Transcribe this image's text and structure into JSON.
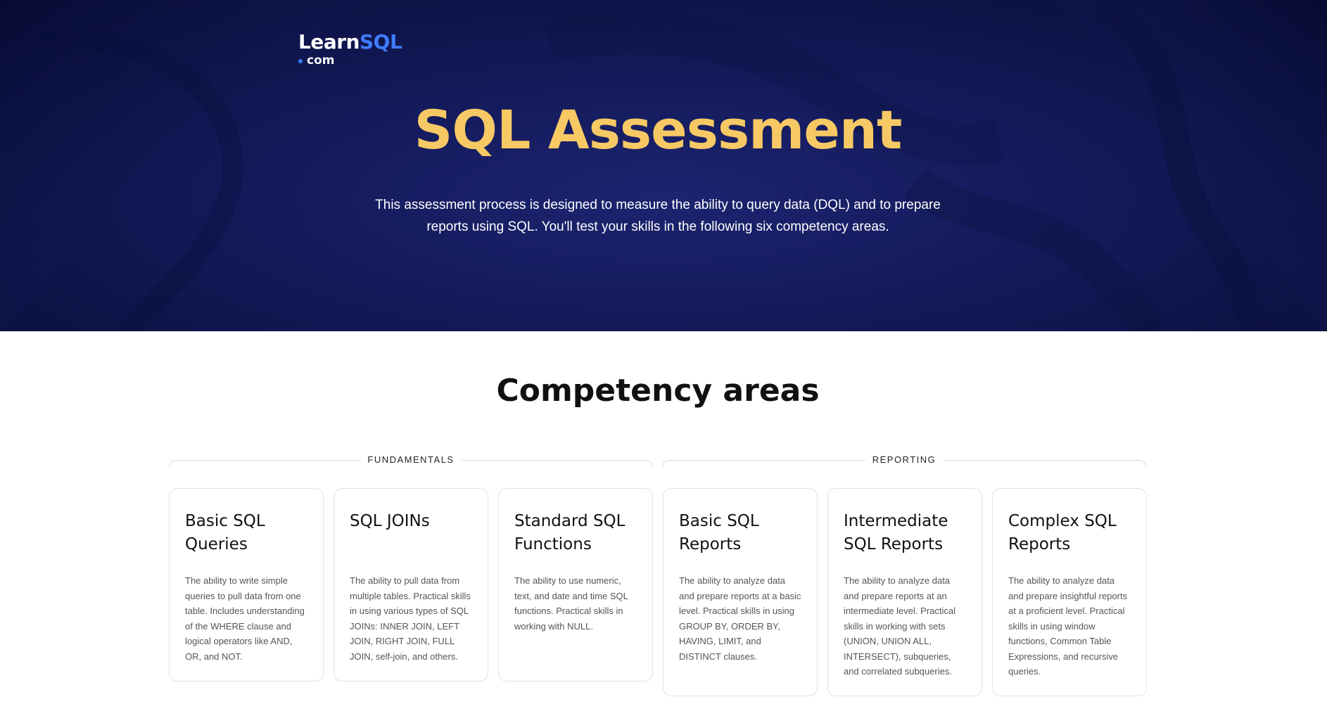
{
  "logo": {
    "part1": "Learn",
    "part2": "SQL",
    "sub": "com"
  },
  "hero": {
    "title": "SQL Assessment",
    "description": "This assessment process is designed to measure the ability to query data (DQL) and to prepare reports using SQL. You'll test your skills in the following six competency areas."
  },
  "competency": {
    "title": "Competency areas",
    "groups": [
      {
        "label": "FUNDAMENTALS"
      },
      {
        "label": "REPORTING"
      }
    ],
    "cards": [
      {
        "title": "Basic SQL Queries",
        "description": "The ability to write simple queries to pull data from one table. Includes understanding of the WHERE clause and logical operators like AND, OR, and NOT."
      },
      {
        "title": "SQL JOINs",
        "description": "The ability to pull data from multiple tables. Practical skills in using various types of SQL JOINs: INNER JOIN, LEFT JOIN, RIGHT JOIN, FULL JOIN, self-join, and others."
      },
      {
        "title": "Standard SQL Functions",
        "description": "The ability to use numeric, text, and date and time SQL functions. Practical skills in working with NULL."
      },
      {
        "title": "Basic SQL Reports",
        "description": "The ability to analyze data and prepare reports at a basic level. Practical skills in using GROUP BY, ORDER BY, HAVING, LIMIT, and DISTINCT clauses."
      },
      {
        "title": "Intermediate SQL Reports",
        "description": "The ability to analyze data and prepare reports at an intermediate level. Practical skills in working with sets (UNION, UNION ALL, INTERSECT), subqueries, and correlated subqueries."
      },
      {
        "title": "Complex SQL Reports",
        "description": "The ability to analyze data and prepare insightful reports at a proficient level. Practical skills in using window functions, Common Table Expressions, and recursive queries."
      }
    ]
  },
  "colors": {
    "hero_bg": "#141b5c",
    "title_accent": "#f7c964",
    "logo_accent": "#3f7cff"
  }
}
